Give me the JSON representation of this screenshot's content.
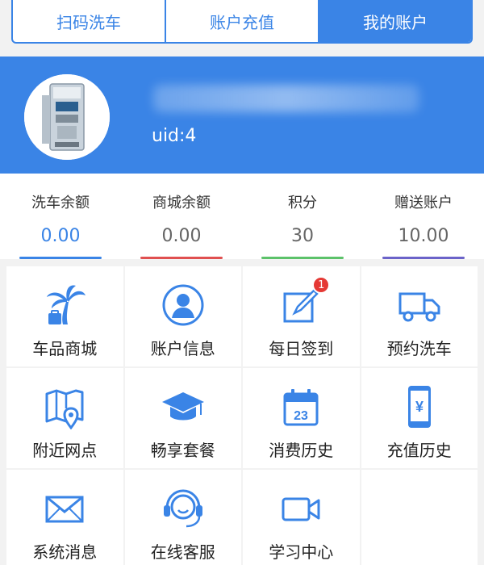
{
  "tabs": [
    {
      "label": "扫码洗车"
    },
    {
      "label": "账户充值"
    },
    {
      "label": "我的账户"
    }
  ],
  "header": {
    "uid": "uid:4"
  },
  "balances": [
    {
      "label": "洗车余额",
      "value": "0.00",
      "color": "#3a84e6"
    },
    {
      "label": "商城余额",
      "value": "0.00",
      "color": "#e05050"
    },
    {
      "label": "积分",
      "value": "30",
      "color": "#5cc26a"
    },
    {
      "label": "赠送账户",
      "value": "10.00",
      "color": "#6b63c9"
    }
  ],
  "menu": [
    {
      "label": "车品商城",
      "icon": "palm-tree-icon"
    },
    {
      "label": "账户信息",
      "icon": "user-icon"
    },
    {
      "label": "每日签到",
      "icon": "checkin-icon",
      "badge": "1"
    },
    {
      "label": "预约洗车",
      "icon": "truck-icon"
    },
    {
      "label": "附近网点",
      "icon": "map-icon"
    },
    {
      "label": "畅享套餐",
      "icon": "graduation-cap-icon"
    },
    {
      "label": "消费历史",
      "icon": "calendar-icon",
      "calendar_day": "23"
    },
    {
      "label": "充值历史",
      "icon": "phone-yuan-icon",
      "currency": "¥"
    },
    {
      "label": "系统消息",
      "icon": "envelope-icon"
    },
    {
      "label": "在线客服",
      "icon": "headset-icon"
    },
    {
      "label": "学习中心",
      "icon": "video-icon"
    }
  ],
  "accent": "#3a84e6"
}
